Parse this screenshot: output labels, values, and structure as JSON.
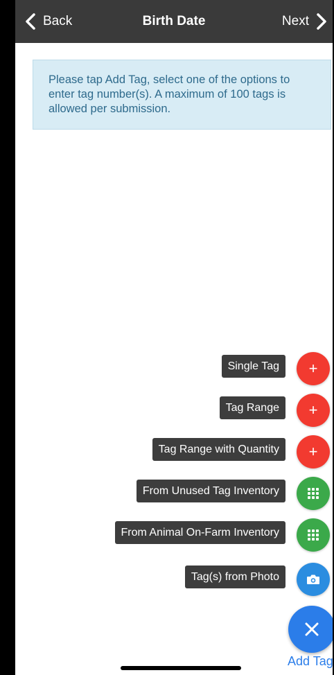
{
  "nav": {
    "back_label": "Back",
    "title": "Birth Date",
    "next_label": "Next"
  },
  "info": {
    "message": "Please tap Add Tag, select one of the options to enter tag number(s). A maximum of 100 tags is allowed per submission."
  },
  "fab_menu": {
    "items": [
      {
        "label": "Single Tag",
        "icon": "plus-icon",
        "color": "#f23a30"
      },
      {
        "label": "Tag Range",
        "icon": "plus-icon",
        "color": "#f23a30"
      },
      {
        "label": "Tag Range with Quantity",
        "icon": "plus-icon",
        "color": "#f23a30"
      },
      {
        "label": "From Unused Tag Inventory",
        "icon": "keypad-grid-icon",
        "color": "#3ba94a"
      },
      {
        "label": "From Animal On-Farm Inventory",
        "icon": "keypad-grid-icon",
        "color": "#3ba94a"
      },
      {
        "label": "Tag(s) from Photo",
        "icon": "camera-icon",
        "color": "#2b8de0"
      }
    ],
    "main_icon": "close-icon",
    "main_label": "Add Tag",
    "main_color": "#2b7de9"
  },
  "colors": {
    "navbar": "#3a3a3a",
    "info_background": "#d8ecf5",
    "info_text": "#2e6a8c"
  }
}
